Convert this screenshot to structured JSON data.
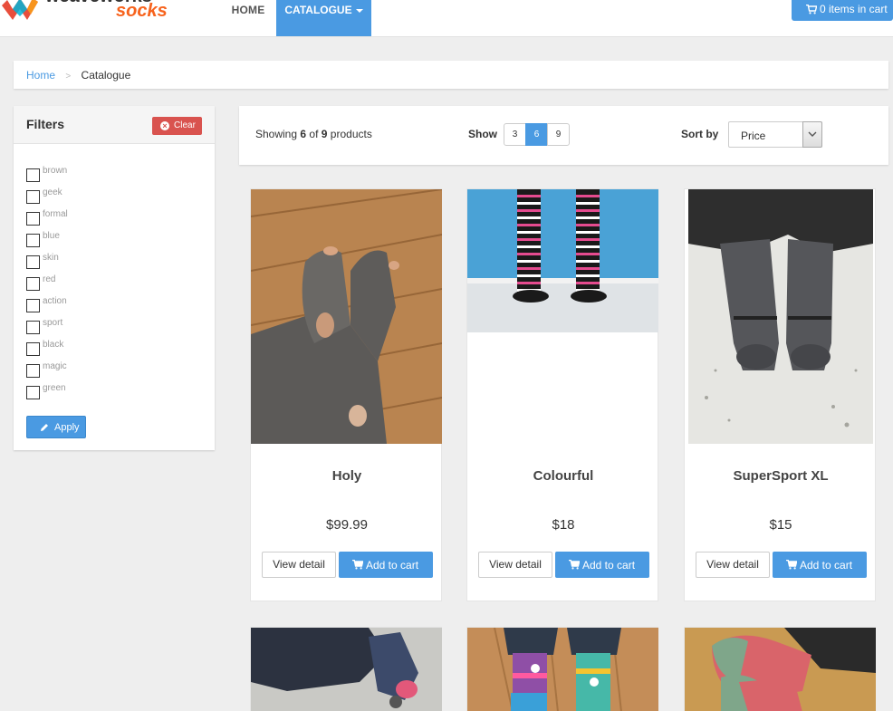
{
  "header": {
    "logo_text": "weaveworks socks",
    "nav_home": "HOME",
    "nav_catalogue": "CATALOGUE",
    "cart_label": "0 items in cart"
  },
  "breadcrumb": {
    "home": "Home",
    "current": "Catalogue"
  },
  "filters": {
    "title": "Filters",
    "clear_label": "Clear",
    "apply_label": "Apply",
    "options": [
      "brown",
      "geek",
      "formal",
      "blue",
      "skin",
      "red",
      "action",
      "sport",
      "black",
      "magic",
      "green"
    ]
  },
  "toolbar": {
    "showing_prefix": "Showing",
    "showing_count": "6",
    "showing_of": "of",
    "showing_total": "9",
    "showing_suffix": "products",
    "show_label": "Show",
    "page_sizes": [
      "3",
      "6",
      "9"
    ],
    "active_page_size": "6",
    "sort_label": "Sort by",
    "sort_value": "Price"
  },
  "products": [
    {
      "name": "Holy",
      "price": "$99.99",
      "detail_label": "View detail",
      "cart_label": "Add to cart"
    },
    {
      "name": "Colourful",
      "price": "$18",
      "detail_label": "View detail",
      "cart_label": "Add to cart"
    },
    {
      "name": "SuperSport XL",
      "price": "$15",
      "detail_label": "View detail",
      "cart_label": "Add to cart"
    }
  ],
  "colors": {
    "accent": "#4a9ae2",
    "danger": "#d9534f",
    "background": "#eeeeee"
  }
}
